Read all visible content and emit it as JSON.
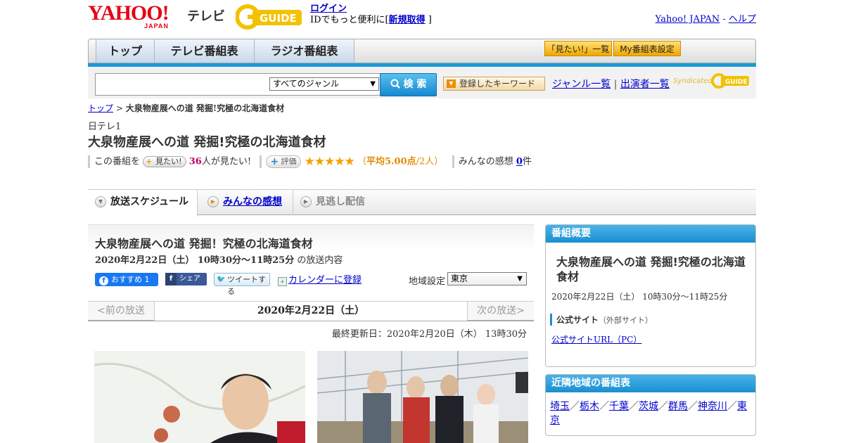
{
  "header": {
    "logo_text": "YAHOO!",
    "logo_sub": "JAPAN",
    "logo_tv": "テレビ",
    "gguide": "G-GUIDE",
    "login": "ログイン",
    "id_text": "IDでもっと便利に[",
    "signup": "新規取得",
    "id_close": "]",
    "yahoo_japan": "Yahoo! JAPAN",
    "link_sep": "-",
    "help": "ヘルプ"
  },
  "nav": {
    "tabs": [
      "トップ",
      "テレビ番組表",
      "ラジオ番組表"
    ],
    "mitai_list": "「見たい!」一覧",
    "my_schedule": "My番組表設定"
  },
  "search": {
    "genre": "すべてのジャンル",
    "button": "検 索",
    "keyword_btn": "登録したキーワード",
    "genre_list": "ジャンル一覧",
    "link_sep": "|",
    "cast_list": "出演者一覧",
    "syndicated": "Syndicated"
  },
  "breadcrumb": {
    "top": "トップ",
    "sep": ">",
    "current": "大泉物産展への道 発掘!究極の北海道食材"
  },
  "program": {
    "channel": "日テレ1",
    "title": "大泉物産展への道 発掘!究極の北海道食材",
    "prefix": "この番組を",
    "mitai_btn": "見たい!",
    "mitai_count": "36",
    "mitai_suffix": "人が見たい!",
    "hyoka_btn": "評価",
    "stars": "★★★★★",
    "rating": 5.0,
    "avg_prefix": "（",
    "avg_label": "平均5.00点",
    "avg_people": "/2人）",
    "kanso_label": "みんなの感想",
    "kanso_count": "0",
    "kanso_suffix": "件"
  },
  "content_tabs": [
    "放送スケジュール",
    "みんなの感想",
    "見逃し配信"
  ],
  "main": {
    "title": "大泉物産展への道 発掘！究極の北海道食材",
    "datetime": "2020年2月22日（土） 10時30分～11時25分",
    "datetime_suffix": "の放送内容",
    "fb_recommend": "おすすめ 1",
    "fb_share": "シェア",
    "tweet": "ツイートする",
    "calendar": "カレンダーに登録",
    "region_label": "地域設定",
    "region": "東京",
    "prev": "<前の放送",
    "date": "2020年2月22日（土）",
    "next": "次の放送>",
    "updated": "最終更新日：2020年2月20日（木） 13時30分"
  },
  "sidebar": {
    "overview_header": "番組概要",
    "overview_title": "大泉物産展への道 発掘!究極の北海道食材",
    "overview_date": "2020年2月22日（土） 10時30分～11時25分",
    "official_site": "公式サイト",
    "official_note": "（外部サイト）",
    "official_url": "公式サイトURL（PC）",
    "nearby_header": "近隣地域の番組表",
    "region_sep": "／",
    "regions": [
      "埼玉",
      "栃木",
      "千葉",
      "茨城",
      "群馬",
      "神奈川",
      "東京"
    ]
  }
}
